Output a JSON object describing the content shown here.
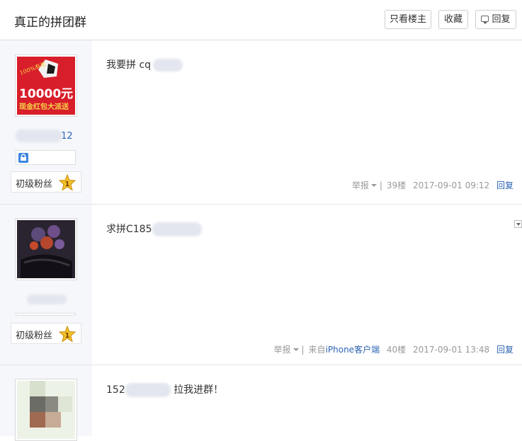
{
  "header": {
    "title": "真正的拼团群",
    "buttons": {
      "only_op": "只看楼主",
      "favorite": "收藏",
      "reply": "回复"
    }
  },
  "posts": [
    {
      "avatar_text": {
        "line1": "100%有奖",
        "line2": "10000元",
        "line3": "现金红包大派送"
      },
      "username_suffix": ".12",
      "fan_level": "初级粉丝",
      "fan_badge_num": "1",
      "content_prefix": "我要拼 cq",
      "report": "举报",
      "floor": "39楼",
      "time": "2017-09-01 09:12",
      "reply": "回复"
    },
    {
      "fan_level": "初级粉丝",
      "fan_badge_num": "1",
      "content_prefix": "求拼C185",
      "report": "举报",
      "source_prefix": "来自",
      "source_client": "iPhone客户端",
      "floor": "40楼",
      "time": "2017-09-01 13:48",
      "reply": "回复"
    },
    {
      "content_prefix": "152",
      "content_suffix": "拉我进群！"
    }
  ],
  "colors": {
    "link": "#2d64b3",
    "meta": "#999999",
    "sidebar": "#f5f7fb",
    "avatar_red": "#d81e2a"
  }
}
